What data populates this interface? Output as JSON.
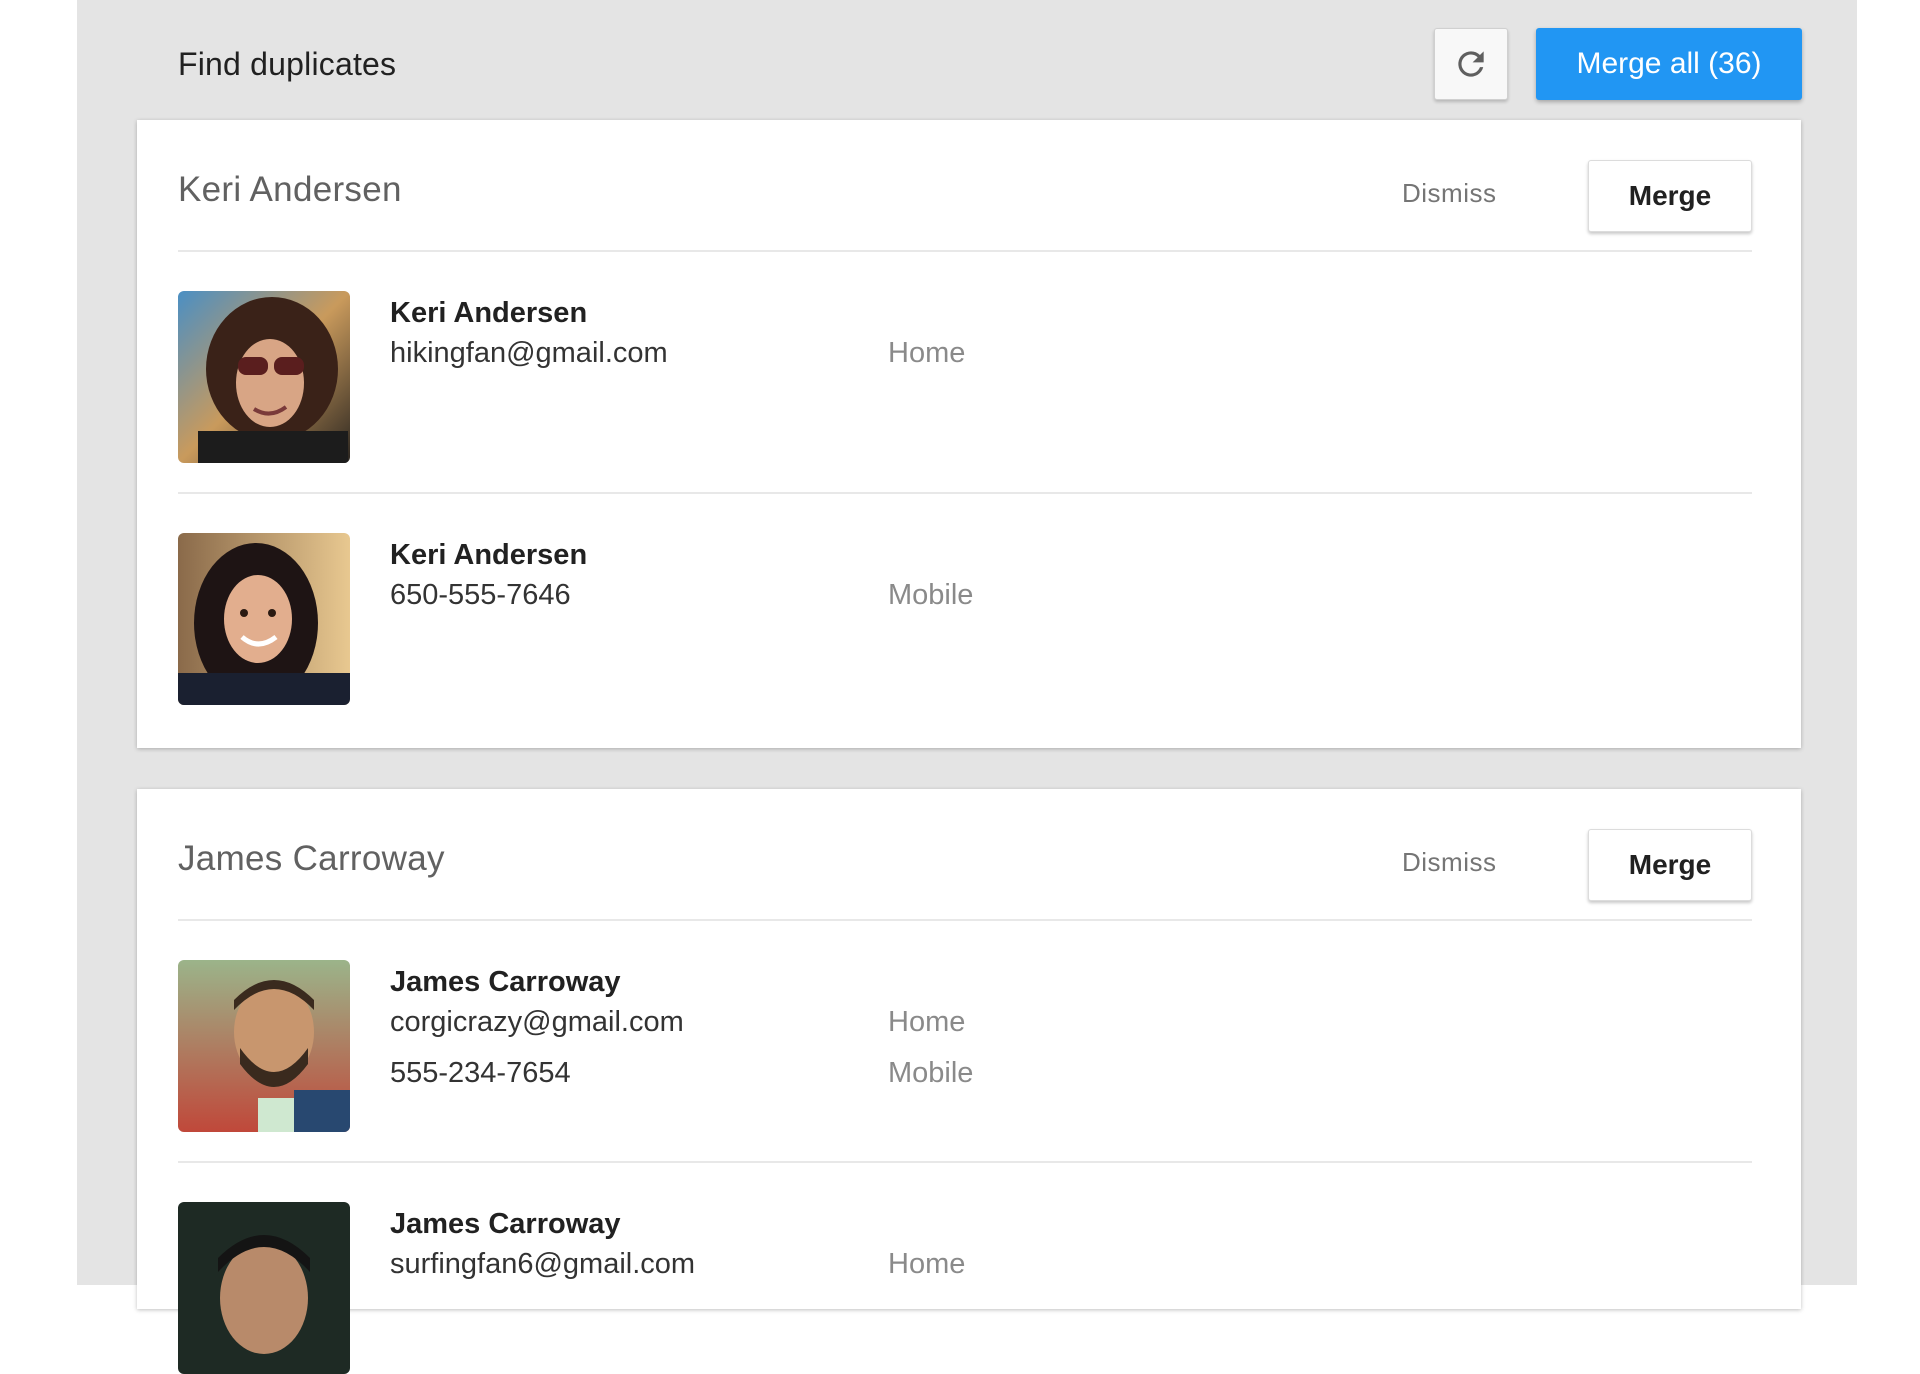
{
  "header": {
    "title": "Find duplicates",
    "refresh_icon": "refresh-icon",
    "merge_all_label": "Merge all (36)"
  },
  "colors": {
    "accent": "#2196f3",
    "panel_background": "#e4e4e4",
    "card_background": "#ffffff"
  },
  "groups": [
    {
      "title": "Keri Andersen",
      "dismiss_label": "Dismiss",
      "merge_label": "Merge",
      "contacts": [
        {
          "name": "Keri Andersen",
          "details": [
            {
              "value": "hikingfan@gmail.com",
              "type": "Home"
            }
          ]
        },
        {
          "name": "Keri Andersen",
          "details": [
            {
              "value": "650-555-7646",
              "type": "Mobile"
            }
          ]
        }
      ]
    },
    {
      "title": "James Carroway",
      "dismiss_label": "Dismiss",
      "merge_label": "Merge",
      "contacts": [
        {
          "name": "James Carroway",
          "details": [
            {
              "value": "corgicrazy@gmail.com",
              "type": "Home"
            },
            {
              "value": "555-234-7654",
              "type": "Mobile"
            }
          ]
        },
        {
          "name": "James Carroway",
          "details": [
            {
              "value": "surfingfan6@gmail.com",
              "type": "Home"
            }
          ]
        }
      ]
    }
  ]
}
